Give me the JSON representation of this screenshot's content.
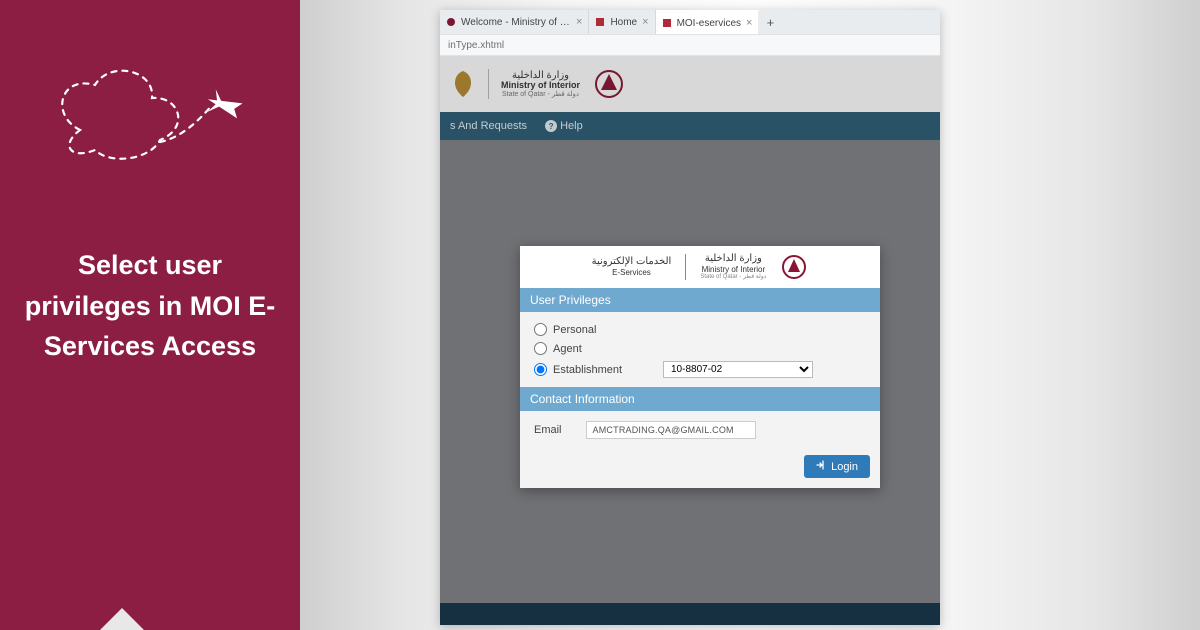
{
  "instruction": "Select user privileges in MOI E-Services Access",
  "browser": {
    "tabs": [
      {
        "title": "Welcome - Ministry of Labour",
        "active": false
      },
      {
        "title": "Home",
        "active": false
      },
      {
        "title": "MOI-eservices",
        "active": true
      }
    ],
    "new_tab": "+",
    "url_fragment": "inType.xhtml"
  },
  "moi_header": {
    "name_ar": "وزارة الداخلية",
    "name_en": "Ministry of Interior",
    "sub": "State of Qatar - دولة قطر"
  },
  "nav": {
    "item1": "s And Requests",
    "help": "Help"
  },
  "card": {
    "eservices_ar": "الخدمات الإلكترونية",
    "eservices_en": "E-Services",
    "moi_ar": "وزارة الداخلية",
    "moi_en": "Ministry of Interior",
    "moi_sub": "State of Qatar - دولة قطر",
    "section_privileges": "User Privileges",
    "opt_personal": "Personal",
    "opt_agent": "Agent",
    "opt_establishment": "Establishment",
    "establishment_value": "10-8807-02",
    "section_contact": "Contact Information",
    "email_label": "Email",
    "email_value": "AMCTRADING.QA@GMAIL.COM",
    "login": "Login"
  }
}
